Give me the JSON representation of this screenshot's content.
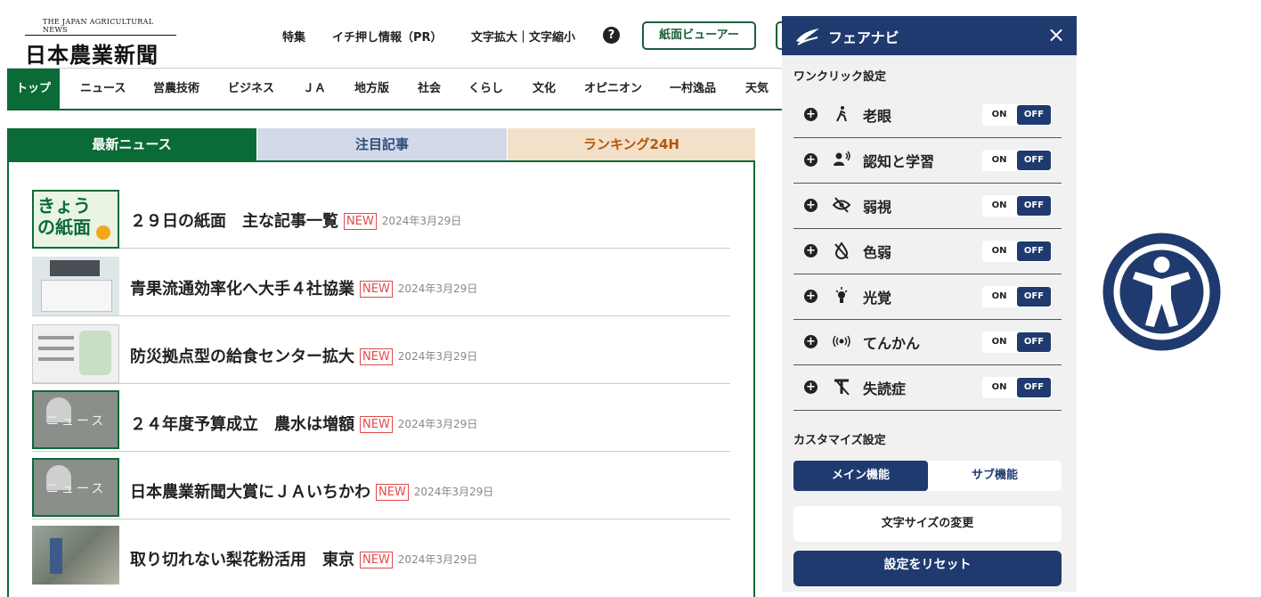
{
  "header": {
    "logo_en": "THE JAPAN AGRICULTURAL NEWS",
    "logo_ja": "日本農業新聞",
    "links": [
      "特集",
      "イチ押し情報（PR）",
      "文字拡大｜文字縮小"
    ],
    "help_icon": "?",
    "viewer_button": "紙面ビューアー"
  },
  "nav": {
    "items": [
      "トップ",
      "ニュース",
      "営農技術",
      "ビジネス",
      "ＪＡ",
      "地方版",
      "社会",
      "くらし",
      "文化",
      "オピニオン",
      "一村逸品",
      "天気"
    ]
  },
  "tabs": [
    "最新ニュース",
    "注目記事",
    "ランキング24H"
  ],
  "news": [
    {
      "title": "２９日の紙面　主な記事一覧",
      "tag": "NEW",
      "date": "2024年3月29日",
      "thumb_text": "きょうの紙面"
    },
    {
      "title": "青果流通効率化へ大手４社協業",
      "tag": "NEW",
      "date": "2024年3月29日"
    },
    {
      "title": "防災拠点型の給食センター拡大",
      "tag": "NEW",
      "date": "2024年3月29日"
    },
    {
      "title": "２４年度予算成立　農水は増額",
      "tag": "NEW",
      "date": "2024年3月29日",
      "thumb_text": "ニュース"
    },
    {
      "title": "日本農業新聞大賞にＪＡいちかわ",
      "tag": "NEW",
      "date": "2024年3月29日",
      "thumb_text": "ニュース"
    },
    {
      "title": "取り切れない梨花粉活用　東京",
      "tag": "NEW",
      "date": "2024年3月29日"
    }
  ],
  "panel": {
    "title": "フェアナビ",
    "close": "×",
    "oneclick_title": "ワンクリック設定",
    "features": [
      {
        "label": "老眼",
        "icon": "walking-person-icon",
        "on": "ON",
        "off": "OFF"
      },
      {
        "label": "認知と学習",
        "icon": "speaking-person-icon",
        "on": "ON",
        "off": "OFF"
      },
      {
        "label": "弱視",
        "icon": "eye-slash-icon",
        "on": "ON",
        "off": "OFF"
      },
      {
        "label": "色弱",
        "icon": "color-drop-slash-icon",
        "on": "ON",
        "off": "OFF"
      },
      {
        "label": "光覚",
        "icon": "light-bulb-icon",
        "on": "ON",
        "off": "OFF"
      },
      {
        "label": "てんかん",
        "icon": "broadcast-icon",
        "on": "ON",
        "off": "OFF"
      },
      {
        "label": "失読症",
        "icon": "text-slash-icon",
        "on": "ON",
        "off": "OFF"
      }
    ],
    "custom_title": "カスタマイズ設定",
    "seg_main": "メイン機能",
    "seg_sub": "サブ機能",
    "font_size_button": "文字サイズの変更",
    "reset_button": "設定をリセット"
  },
  "colors": {
    "brand_green": "#0b6b37",
    "panel_navy": "#1f3a6e",
    "new_red": "#e24a4a"
  }
}
